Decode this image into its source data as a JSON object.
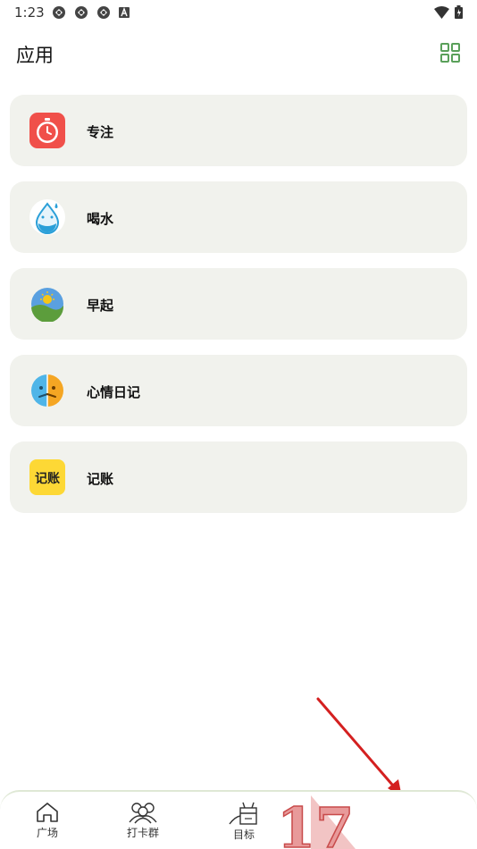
{
  "status_bar": {
    "time": "1:23",
    "icons": [
      "sync-icon",
      "sync-icon",
      "sync-icon",
      "a-badge-icon",
      "wifi-icon",
      "battery-icon"
    ]
  },
  "header": {
    "title": "应用",
    "grid_icon": "grid-view-icon",
    "accent_color": "#5aa05a"
  },
  "apps": [
    {
      "label": "专注",
      "icon": "tomato-timer-icon"
    },
    {
      "label": "喝水",
      "icon": "water-drop-icon"
    },
    {
      "label": "早起",
      "icon": "sunrise-icon"
    },
    {
      "label": "心情日记",
      "icon": "mood-face-icon"
    },
    {
      "label": "记账",
      "icon": "bookkeeping-icon",
      "icon_text": "记账"
    }
  ],
  "bottom_nav": {
    "items": [
      {
        "label": "广场",
        "icon": "home-icon"
      },
      {
        "label": "打卡群",
        "icon": "group-icon"
      },
      {
        "label": "目标",
        "icon": "target-icon"
      }
    ]
  },
  "overlay": {
    "watermark_text": "17",
    "arrow_color": "#d42020"
  }
}
